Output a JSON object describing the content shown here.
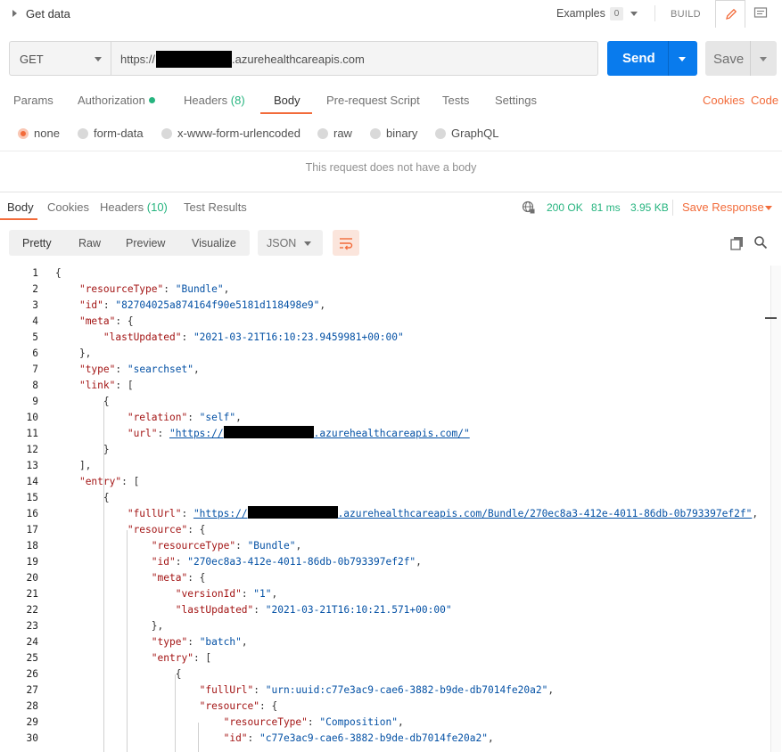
{
  "request": {
    "name": "Get data",
    "examples_label": "Examples",
    "examples_count": "0",
    "build_label": "BUILD",
    "method": "GET",
    "url_prefix": "https://",
    "url_suffix": ".azurehealthcareapis.com",
    "send_label": "Send",
    "save_label": "Save"
  },
  "request_tabs": [
    {
      "label": "Params"
    },
    {
      "label": "Authorization"
    },
    {
      "label": "Headers",
      "count": "(8)"
    },
    {
      "label": "Body"
    },
    {
      "label": "Pre-request Script"
    },
    {
      "label": "Tests"
    },
    {
      "label": "Settings"
    }
  ],
  "request_links": {
    "cookies": "Cookies",
    "code": "Code"
  },
  "body_types": [
    "none",
    "form-data",
    "x-www-form-urlencoded",
    "raw",
    "binary",
    "GraphQL"
  ],
  "no_body_message": "This request does not have a body",
  "response_tabs": [
    {
      "label": "Body"
    },
    {
      "label": "Cookies"
    },
    {
      "label": "Headers",
      "count": "(10)"
    },
    {
      "label": "Test Results"
    }
  ],
  "response_status": {
    "status": "200 OK",
    "time": "81 ms",
    "size": "3.95 KB",
    "save_response": "Save Response"
  },
  "view_modes": [
    "Pretty",
    "Raw",
    "Preview",
    "Visualize"
  ],
  "format": "JSON",
  "accent_color": "#f26b3a",
  "primary_color": "#097bed",
  "success_color": "#26b47f",
  "icons": [
    "collapse-arrow-icon",
    "pencil-icon",
    "comment-icon",
    "globe-icon",
    "wrap-lines-icon",
    "copy-icon",
    "search-icon"
  ],
  "code_lines": [
    "1",
    "2",
    "3",
    "4",
    "5",
    "6",
    "7",
    "8",
    "9",
    "10",
    "11",
    "12",
    "13",
    "14",
    "15",
    "16",
    "17",
    "18",
    "19",
    "20",
    "21",
    "22",
    "23",
    "24",
    "25",
    "26",
    "27",
    "28",
    "29",
    "30"
  ],
  "code": {
    "resourceType_key": "\"resourceType\"",
    "bundle_val": "\"Bundle\"",
    "id_key": "\"id\"",
    "id_val": "\"82704025a874164f90e5181d118498e9\"",
    "meta_key": "\"meta\"",
    "lastUpdated_key": "\"lastUpdated\"",
    "lastUpdated_val": "\"2021-03-21T16:10:23.9459981+00:00\"",
    "type_key": "\"type\"",
    "searchset_val": "\"searchset\"",
    "link_key": "\"link\"",
    "relation_key": "\"relation\"",
    "self_val": "\"self\"",
    "url_key": "\"url\"",
    "url_val_prefix": "\"https://",
    "url_val_suffix": ".azurehealthcareapis.com/\"",
    "entry_key": "\"entry\"",
    "fullUrl_key": "\"fullUrl\"",
    "fullUrl_val_prefix": "\"https://",
    "fullUrl_val_suffix": ".azurehealthcareapis.com/Bundle/270ec8a3-412e-4011-86db-0b793397ef2f\"",
    "resource_key": "\"resource\"",
    "inner_id_val": "\"270ec8a3-412e-4011-86db-0b793397ef2f\"",
    "versionId_key": "\"versionId\"",
    "versionId_val": "\"1\"",
    "inner_lastUpdated_val": "\"2021-03-21T16:10:21.571+00:00\"",
    "batch_val": "\"batch\"",
    "urn_val": "\"urn:uuid:c77e3ac9-cae6-3882-b9de-db7014fe20a2\"",
    "composition_val": "\"Composition\"",
    "comp_id_val": "\"c77e3ac9-cae6-3882-b9de-db7014fe20a2\""
  }
}
